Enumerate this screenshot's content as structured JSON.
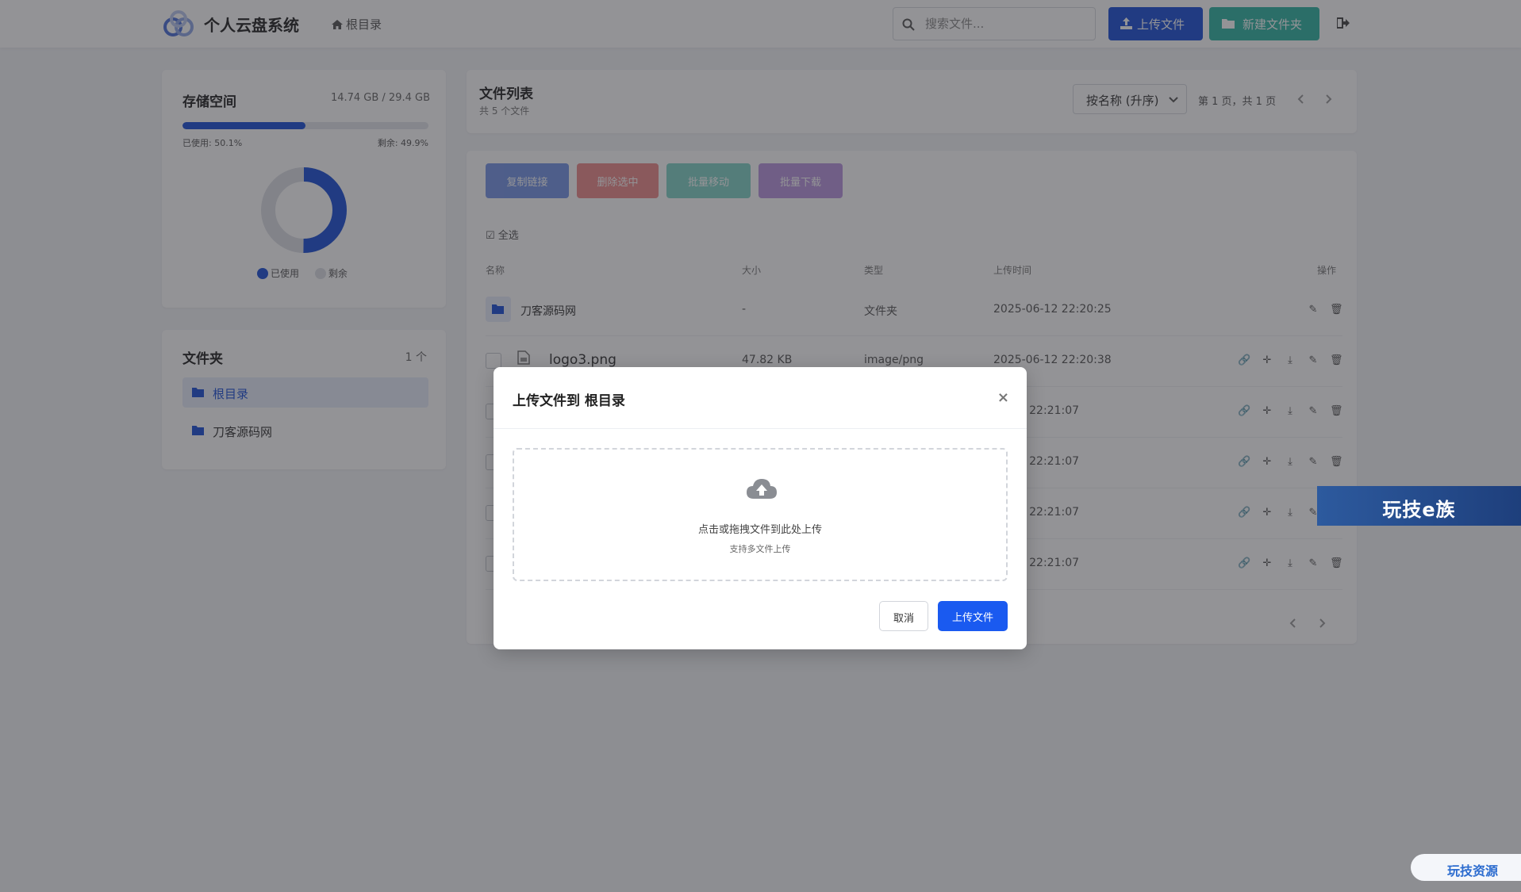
{
  "navbar": {
    "title": "个人云盘系统",
    "breadcrumb": "根目录",
    "search_placeholder": "搜索文件...",
    "upload_label": "上传文件",
    "new_folder_label": "新建文件夹"
  },
  "storage": {
    "title": "存储空间",
    "amount": "14.74 GB / 29.4 GB",
    "used_fraction": 0.501,
    "used_label": "已使用: 50.1%",
    "free_label": "剩余: 49.9%",
    "legend_used": "已使用",
    "legend_free": "剩余",
    "used_color": "#1a4fd6",
    "free_color": "#dcdfe5"
  },
  "folders": {
    "title": "文件夹",
    "count": "1 个",
    "items": [
      {
        "label": "根目录",
        "active": true
      },
      {
        "label": "刀客源码网",
        "active": false
      }
    ]
  },
  "file_list": {
    "title": "文件列表",
    "subtitle": "共 5 个文件",
    "sort_value": "按名称 (升序)",
    "page_info": "第 1 页，共 1 页",
    "batch": {
      "copy": "复制链接",
      "delete": "删除选中",
      "move": "批量移动",
      "download": "批量下载"
    },
    "select_all": "全选",
    "columns": {
      "name": "名称",
      "size": "大小",
      "type": "类型",
      "time": "上传时间",
      "actions": "操作"
    },
    "rows": [
      {
        "name": "刀客源码网",
        "size": "-",
        "type": "文件夹",
        "time": "2025-06-12 22:20:25"
      },
      {
        "name": "logo3.png",
        "size": "47.82 KB",
        "type": "image/png",
        "time": "2025-06-12 22:20:38"
      },
      {
        "time": "06-12 22:21:07"
      },
      {
        "time": "06-12 22:21:07"
      },
      {
        "time": "06-12 22:21:07"
      },
      {
        "time": "06-12 22:21:07"
      }
    ]
  },
  "modal": {
    "title": "上传文件到 根目录",
    "dropzone_main": "点击或拖拽文件到此处上传",
    "dropzone_sub": "支持多文件上传",
    "cancel_label": "取消",
    "confirm_label": "上传文件"
  },
  "watermarks": {
    "banner": "玩技e族",
    "corner": "玩技资源"
  }
}
